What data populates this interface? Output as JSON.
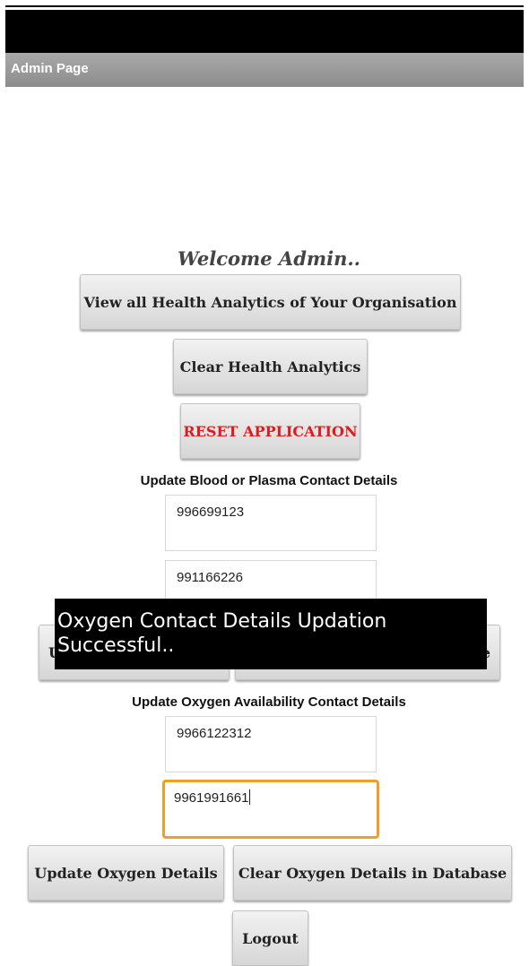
{
  "app": {
    "title": "Admin Page"
  },
  "main": {
    "welcome": "Welcome Admin..",
    "view_analytics_label": "View all Health Analytics of Your Organisation",
    "clear_analytics_label": "Clear Health Analytics",
    "reset_label": "RESET APPLICATION",
    "blood_section_label": "Update Blood or Plasma Contact Details",
    "blood_field_1": "996699123",
    "blood_field_2": "991166226",
    "blood_update_partial": "U",
    "blood_clear_partial": "e",
    "oxygen_section_label": "Update Oxygen Availability Contact Details",
    "oxygen_field_1": "9966122312",
    "oxygen_field_2": "9961991661",
    "update_oxygen_label": "Update Oxygen Details",
    "clear_oxygen_label": "Clear Oxygen Details in Database",
    "logout_label": "Logout"
  },
  "toast": {
    "message": "Oxygen Contact Details Updation Successful.."
  },
  "colors": {
    "danger": "#e01b1b",
    "focus": "#f29d2a",
    "titlebar": "#999999"
  }
}
